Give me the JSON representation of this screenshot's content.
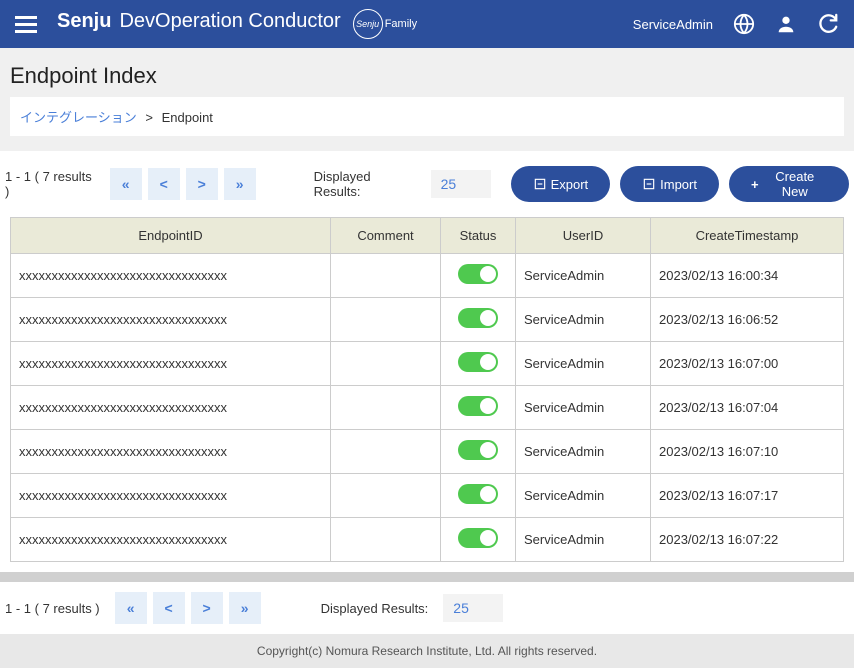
{
  "header": {
    "brand_bold": "Senju",
    "brand_rest": "DevOperation Conductor",
    "brand_family_s": "Senju",
    "brand_family": "Family",
    "username": "ServiceAdmin"
  },
  "page": {
    "title": "Endpoint Index",
    "breadcrumb_link": "インテグレーション",
    "breadcrumb_sep": ">",
    "breadcrumb_current": "Endpoint"
  },
  "toolbar": {
    "results": "1 - 1 ( 7 results )",
    "displayed_label": "Displayed Results:",
    "displayed_value": "25",
    "export": "Export",
    "import": "Import",
    "create": "Create New"
  },
  "table": {
    "headers": {
      "endpoint": "EndpointID",
      "comment": "Comment",
      "status": "Status",
      "userid": "UserID",
      "created": "CreateTimestamp"
    },
    "rows": [
      {
        "endpoint": "xxxxxxxxxxxxxxxxxxxxxxxxxxxxxxxx",
        "comment": "",
        "userid": "ServiceAdmin",
        "created": "2023/02/13 16:00:34"
      },
      {
        "endpoint": "xxxxxxxxxxxxxxxxxxxxxxxxxxxxxxxx",
        "comment": "",
        "userid": "ServiceAdmin",
        "created": "2023/02/13 16:06:52"
      },
      {
        "endpoint": "xxxxxxxxxxxxxxxxxxxxxxxxxxxxxxxx",
        "comment": "",
        "userid": "ServiceAdmin",
        "created": "2023/02/13 16:07:00"
      },
      {
        "endpoint": "xxxxxxxxxxxxxxxxxxxxxxxxxxxxxxxx",
        "comment": "",
        "userid": "ServiceAdmin",
        "created": "2023/02/13 16:07:04"
      },
      {
        "endpoint": "xxxxxxxxxxxxxxxxxxxxxxxxxxxxxxxx",
        "comment": "",
        "userid": "ServiceAdmin",
        "created": "2023/02/13 16:07:10"
      },
      {
        "endpoint": "xxxxxxxxxxxxxxxxxxxxxxxxxxxxxxxx",
        "comment": "",
        "userid": "ServiceAdmin",
        "created": "2023/02/13 16:07:17"
      },
      {
        "endpoint": "xxxxxxxxxxxxxxxxxxxxxxxxxxxxxxxx",
        "comment": "",
        "userid": "ServiceAdmin",
        "created": "2023/02/13 16:07:22"
      }
    ]
  },
  "footer": {
    "copyright": "Copyright(c) Nomura Research Institute, Ltd. All rights reserved."
  }
}
